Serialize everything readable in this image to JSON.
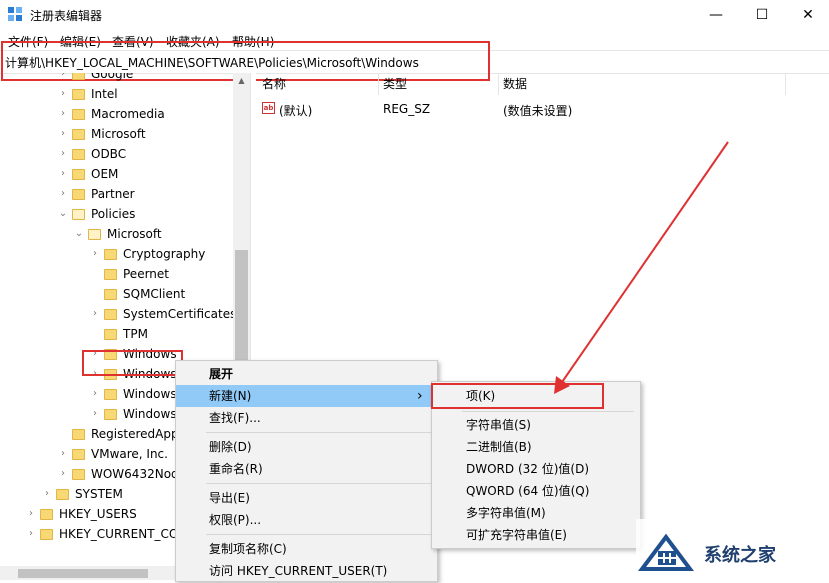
{
  "window": {
    "title": "注册表编辑器",
    "minimize": "—",
    "maximize": "☐",
    "close": "✕"
  },
  "menu": [
    "文件(F)",
    "编辑(E)",
    "查看(V)",
    "收藏夹(A)",
    "帮助(H)"
  ],
  "address": "计算机\\HKEY_LOCAL_MACHINE\\SOFTWARE\\Policies\\Microsoft\\Windows",
  "tree": [
    {
      "label": "Google"
    },
    {
      "label": "Intel"
    },
    {
      "label": "Macromedia"
    },
    {
      "label": "Microsoft"
    },
    {
      "label": "ODBC"
    },
    {
      "label": "OEM"
    },
    {
      "label": "Partner"
    },
    {
      "label": "Policies"
    },
    {
      "label": "Microsoft"
    },
    {
      "label": "Cryptography"
    },
    {
      "label": "Peernet"
    },
    {
      "label": "SQMClient"
    },
    {
      "label": "SystemCertificates"
    },
    {
      "label": "TPM"
    },
    {
      "label": "Windows"
    },
    {
      "label": "Windows"
    },
    {
      "label": "Windows"
    },
    {
      "label": "Windows"
    },
    {
      "label": "RegisteredApp"
    },
    {
      "label": "VMware, Inc."
    },
    {
      "label": "WOW6432Nod"
    },
    {
      "label": "SYSTEM"
    },
    {
      "label": "HKEY_USERS"
    },
    {
      "label": "HKEY_CURRENT_CO"
    }
  ],
  "list": {
    "columns": [
      "名称",
      "类型",
      "数据"
    ],
    "rows": [
      {
        "name": "(默认)",
        "type": "REG_SZ",
        "data": "(数值未设置)",
        "icon": "ab"
      }
    ]
  },
  "context_menu": {
    "items": [
      "展开",
      "新建(N)",
      "查找(F)...",
      "删除(D)",
      "重命名(R)",
      "导出(E)",
      "权限(P)...",
      "复制项名称(C)",
      "访问 HKEY_CURRENT_USER(T)"
    ],
    "submenu_arrow": "›"
  },
  "submenu": {
    "items": [
      "项(K)",
      "字符串值(S)",
      "二进制值(B)",
      "DWORD (32 位)值(D)",
      "QWORD (64 位)值(Q)",
      "多字符串值(M)",
      "可扩充字符串值(E)"
    ]
  },
  "watermark": {
    "text": "系统之家"
  },
  "colors": {
    "highlight": "#91c9f7",
    "annotation_red": "#e03131",
    "folder": "#f8d775"
  }
}
